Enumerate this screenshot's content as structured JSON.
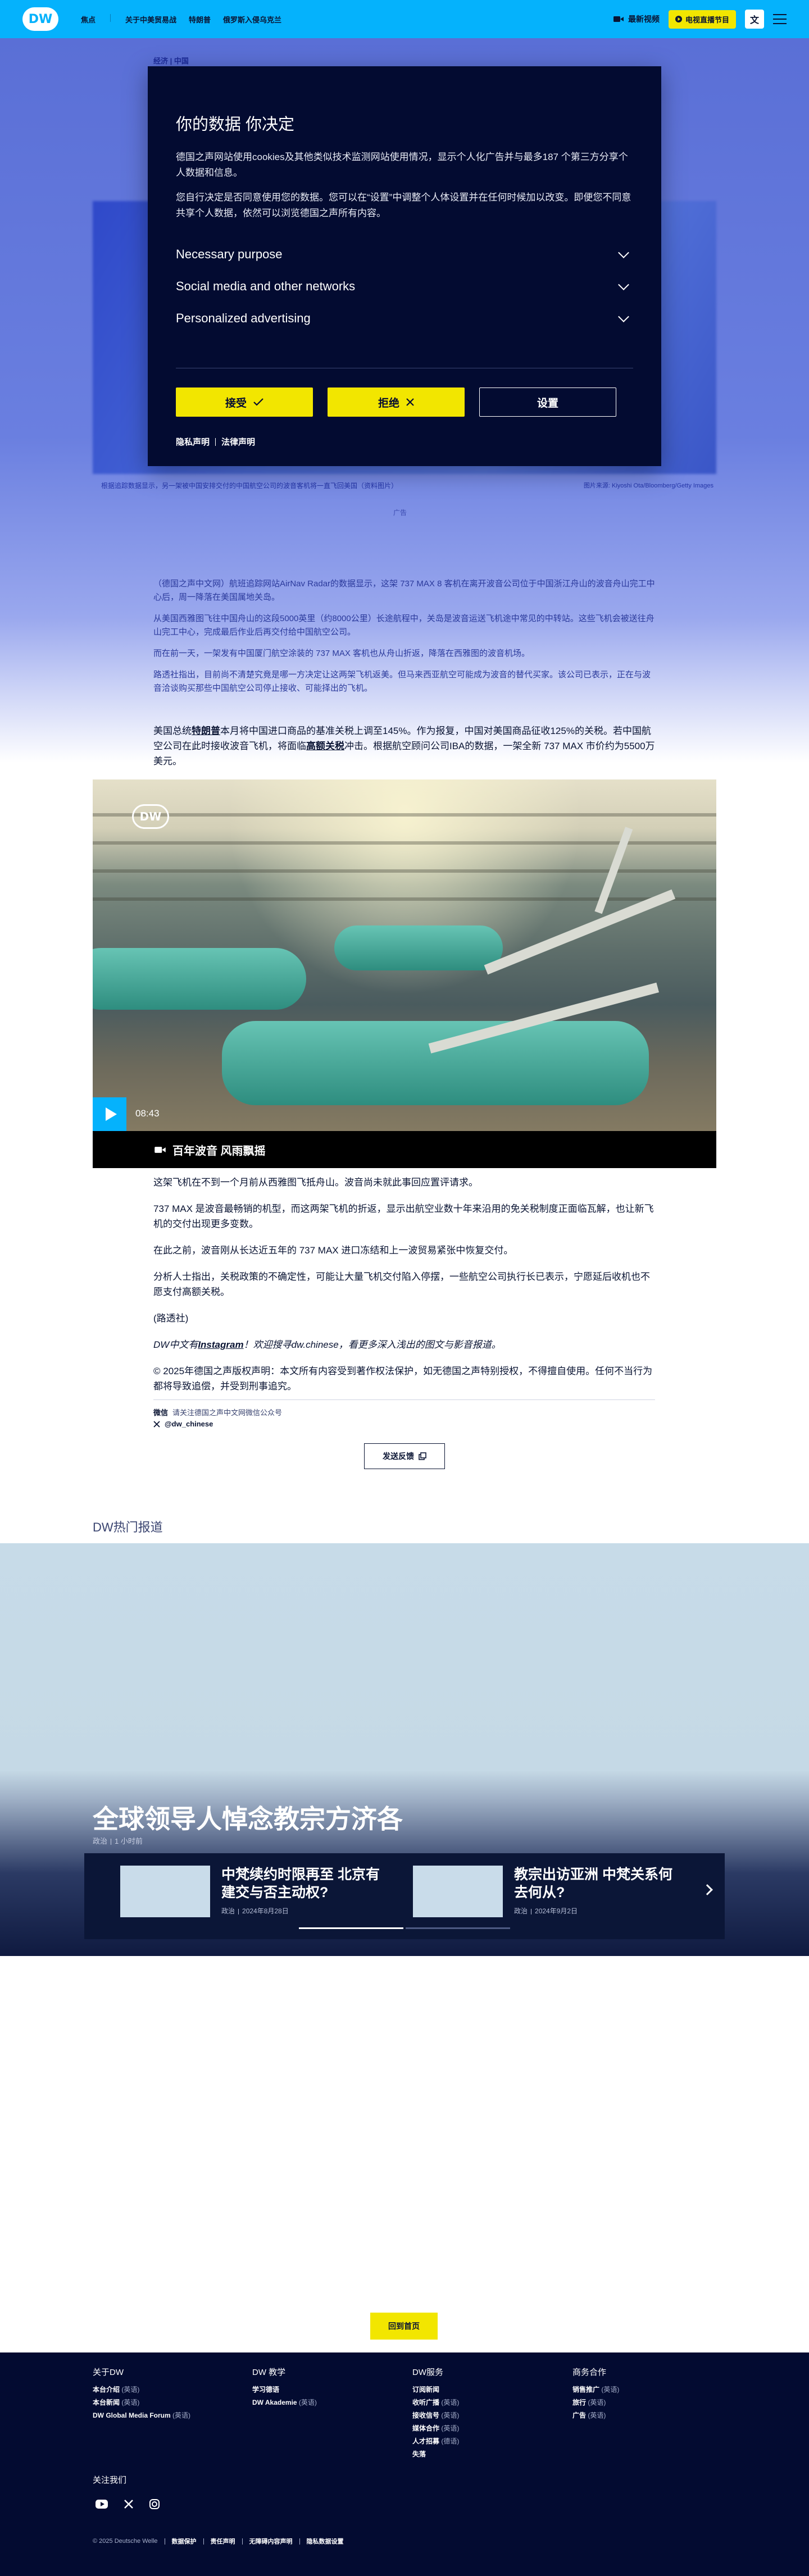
{
  "header": {
    "logo": "DW",
    "nav": [
      "焦点",
      "关于中美贸易战",
      "特朗普",
      "俄罗斯入侵乌克兰"
    ],
    "video_label": "最新视频",
    "live_label": "电视直播节目",
    "lang_label": "文"
  },
  "background": {
    "breadcrumb": "经济 | 中国",
    "caption": "根据追踪数据显示，另一架被中国安排交付的中国航空公司的波音客机将一直飞回美国（资料图片）",
    "copyright": "图片来源: Kiyoshi Ota/Bloomberg/Getty Images",
    "ad_label": "广告",
    "paragraphs": [
      "（德国之声中文网）航班追踪网站AirNav Radar的数据显示，这架 737 MAX 8 客机在离开波音公司位于中国浙江舟山的波音舟山完工中心后，周一降落在美国属地关岛。",
      "从美国西雅图飞往中国舟山的这段5000英里（约8000公里）长途航程中，关岛是波音运送飞机途中常见的中转站。这些飞机会被送往舟山完工中心，完成最后作业后再交付给中国航空公司。",
      "而在前一天，一架发有中国厦门航空涂装的 737 MAX 客机也从舟山折返，降落在西雅图的波音机场。",
      "路透社指出，目前尚不清楚究竟是哪一方决定让这两架飞机返美。但马来西亚航空可能成为波音的替代买家。该公司已表示，正在与波音洽谈购买那些中国航空公司停止接收、可能择出的飞机。"
    ]
  },
  "consent": {
    "title": "你的数据 你决定",
    "intro": "德国之声网站使用cookies及其他类似技术监测网站使用情况，显示个人化广告并与最多187 个第三方分享个人数据和信息。",
    "detail": "您自行决定是否同意使用您的数据。您可以在“设置”中调整个人体设置并在任何时候加以改变。即便您不同意共享个人数据，依然可以浏览德国之声所有内容。",
    "items": [
      "Necessary purpose",
      "Social media and other networks",
      "Personalized advertising"
    ],
    "accept": "接受",
    "reject": "拒绝",
    "settings": "设置",
    "privacy": "隐私声明",
    "legal": "法律声明"
  },
  "article": {
    "p_tariff_pre": "美国总统",
    "p_tariff_link1": "特朗普",
    "p_tariff_mid": "本月将中国进口商品的基准关税上调至145%。作为报复，中国对美国商品征收125%的关税。若中国航空公司在此时接收波音飞机，将面临",
    "p_tariff_link2": "高额关税",
    "p_tariff_post": "冲击。根据航空顾问公司IBA的数据，一架全新 737 MAX 市价约为5500万美元。",
    "video_duration": "08:43",
    "video_title": "百年波音 风雨飘摇",
    "paragraphs": [
      "这架飞机在不到一个月前从西雅图飞抵舟山。波音尚未就此事回应置评请求。",
      "737 MAX 是波音最畅销的机型，而这两架飞机的折返，显示出航空业数十年来沿用的免关税制度正面临瓦解，也让新飞机的交付出现更多变数。",
      "在此之前，波音刚从长达近五年的 737 MAX 进口冻结和上一波贸易紧张中恢复交付。",
      "分析人士指出，关税政策的不确定性，可能让大量飞机交付陷入停摆，一些航空公司执行长已表示，宁愿延后收机也不愿支付高额关税。",
      "(路透社)"
    ],
    "ig_pre": "DW中文有",
    "ig_link": "Instagram",
    "ig_post": "！欢迎搜寻dw.chinese，看更多深入浅出的图文与影音报道。",
    "copyright": "© 2025年德国之声版权声明：本文所有内容受到著作权法保护，如无德国之声特别授权，不得擅自使用。任何不当行为都将导致追偿，并受到刑事追究。",
    "social_bold": "微信",
    "social_rest": "请关注德国之声中文网微信公众号",
    "x_handle": "@dw_chinese",
    "feedback": "发送反馈"
  },
  "hot": {
    "label": "DW热门报道",
    "hero_title": "全球领导人悼念教宗方济各",
    "hero_meta_cat": "政治",
    "hero_meta_time": "1 小时前",
    "cards": [
      {
        "title": "中梵续约时限再至 北京有建交与否主动权?",
        "cat": "政治",
        "date": "2024年8月28日"
      },
      {
        "title": "教宗出访亚洲 中梵关系何去何从?",
        "cat": "政治",
        "date": "2024年9月2日"
      }
    ]
  },
  "footer": {
    "back_to_top": "回到首页",
    "columns": [
      {
        "title": "关于DW",
        "items": [
          {
            "t": "本台介绍",
            "l": "(英语)"
          },
          {
            "t": "本台新闻",
            "l": "(英语)"
          },
          {
            "t": "DW Global Media Forum",
            "l": "(英语)"
          }
        ]
      },
      {
        "title": "DW 教学",
        "items": [
          {
            "t": "学习德语",
            "l": ""
          },
          {
            "t": "DW Akademie",
            "l": "(英语)"
          }
        ]
      },
      {
        "title": "DW服务",
        "items": [
          {
            "t": "订阅新闻",
            "l": ""
          },
          {
            "t": "收听广播",
            "l": "(英语)"
          },
          {
            "t": "接收信号",
            "l": "(英语)"
          },
          {
            "t": "媒体合作",
            "l": "(英语)"
          },
          {
            "t": "人才招募",
            "l": "(德语)"
          },
          {
            "t": "失落",
            "l": ""
          }
        ]
      },
      {
        "title": "商务合作",
        "items": [
          {
            "t": "销售推广",
            "l": "(英语)"
          },
          {
            "t": "旅行",
            "l": "(英语)"
          },
          {
            "t": "广告",
            "l": "(英语)"
          }
        ]
      }
    ],
    "follow": "关注我们",
    "legal_first": "© 2025 Deutsche Welle",
    "legal": [
      "数据保护",
      "责任声明",
      "无障碍内容声明",
      "隐私数据设置"
    ]
  }
}
